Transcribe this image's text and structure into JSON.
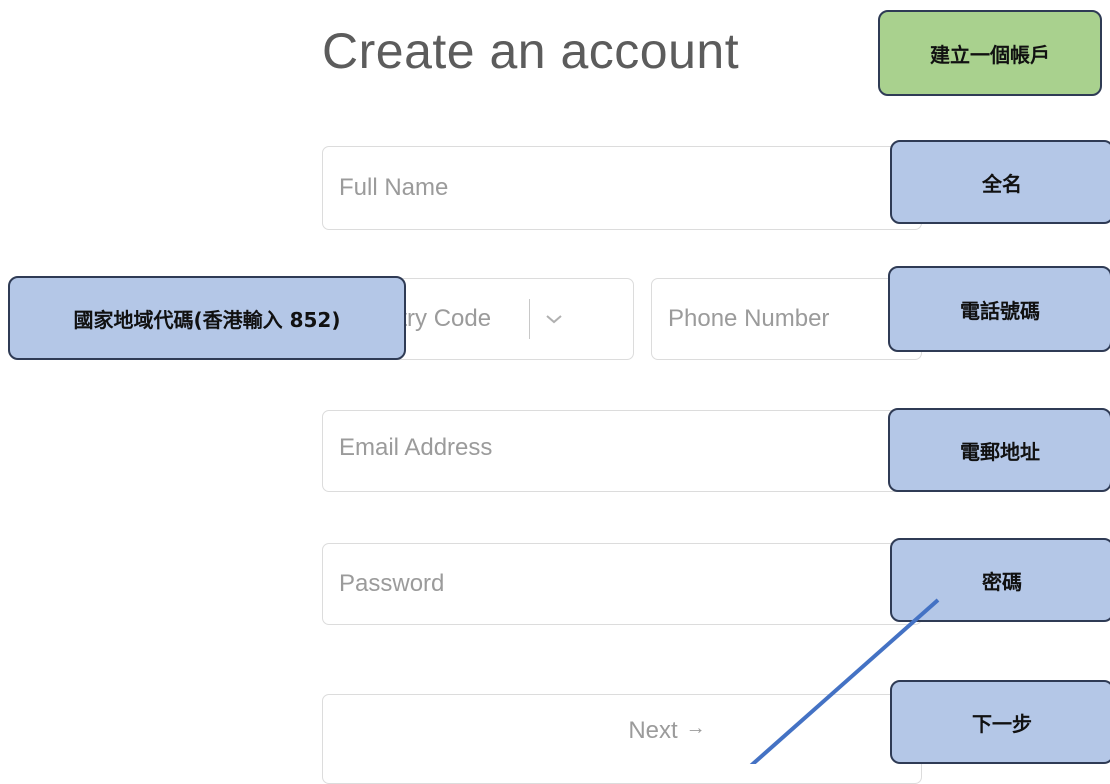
{
  "form": {
    "title": "Create an account",
    "full_name_placeholder": "Full Name",
    "country_code_placeholder": "Country Code",
    "phone_placeholder": "Phone Number",
    "email_placeholder": "Email Address",
    "password_placeholder": "Password",
    "next_label": "Next",
    "next_arrow": "→"
  },
  "annotations": {
    "create_account": "建立一個帳戶",
    "full_name": "全名",
    "country_code": "國家地域代碼(香港輸入 852)",
    "phone": "電話號碼",
    "email": "電郵地址",
    "password": "密碼",
    "next": "下一步"
  },
  "colors": {
    "callout_blue": "#b4c7e7",
    "callout_green": "#a9d18e",
    "pointer_line": "#4472c4"
  },
  "icons": {
    "country_dropdown": "chevron-down-icon"
  }
}
